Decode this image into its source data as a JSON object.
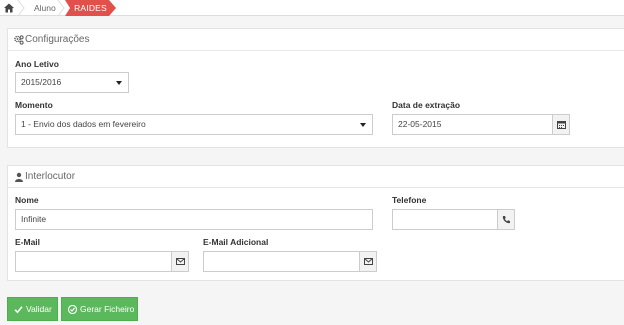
{
  "breadcrumb": {
    "home_icon": "home-icon",
    "items": [
      "Aluno"
    ],
    "active": "RAIDES"
  },
  "config": {
    "title": "Configurações",
    "icon": "cogs-icon",
    "ano_letivo_label": "Ano Letivo",
    "ano_letivo_value": "2015/2016",
    "momento_label": "Momento",
    "momento_value": "1 - Envio dos dados em fevereiro",
    "data_label": "Data de extração",
    "data_value": "22-05-2015",
    "calendar_icon": "calendar-icon"
  },
  "interlocutor": {
    "title": "Interlocutor",
    "icon": "user-icon",
    "nome_label": "Nome",
    "nome_value": "Infinite",
    "telefone_label": "Telefone",
    "telefone_value": "",
    "email_label": "E-Mail",
    "email_value": "",
    "email_adicional_label": "E-Mail Adicional",
    "email_adicional_value": "",
    "phone_icon": "phone-icon",
    "envelope_icon": "envelope-icon"
  },
  "actions": {
    "validar_label": "Validar",
    "gerar_label": "Gerar Ficheiro",
    "accent": "#5cb85c"
  }
}
